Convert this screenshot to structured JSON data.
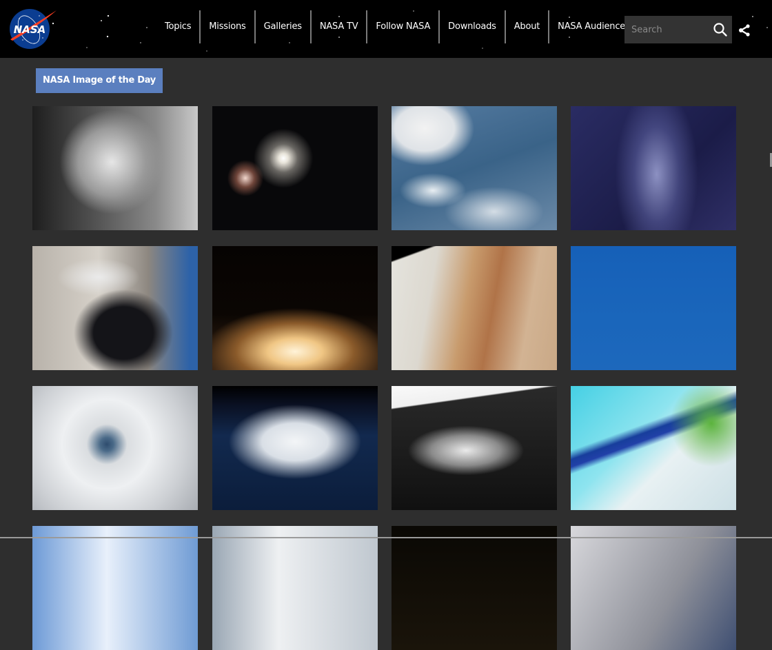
{
  "header": {
    "logo_alt": "NASA",
    "logo_text": "NASA",
    "nav": [
      {
        "label": "Topics"
      },
      {
        "label": "Missions"
      },
      {
        "label": "Galleries"
      },
      {
        "label": "NASA TV"
      },
      {
        "label": "Follow NASA"
      },
      {
        "label": "Downloads"
      },
      {
        "label": "About"
      },
      {
        "label": "NASA Audiences ·"
      }
    ],
    "search": {
      "placeholder": "Search",
      "value": ""
    },
    "icons": {
      "search": "search-icon",
      "share": "share-icon"
    }
  },
  "page": {
    "title": "NASA Image of the Day"
  },
  "gallery": {
    "items": [
      {
        "subject": "astronaut-in-helmet-bw",
        "colors": [
          "#2a2a2a",
          "#d8d8d8"
        ]
      },
      {
        "subject": "galaxy-bright-core",
        "colors": [
          "#0a0a0c",
          "#f0efe8"
        ]
      },
      {
        "subject": "cubesat-over-earth",
        "colors": [
          "#3c5f87",
          "#e6ebef"
        ]
      },
      {
        "subject": "milky-way",
        "colors": [
          "#1d1f4a",
          "#8e8fc4"
        ]
      },
      {
        "subject": "astronaut-with-camera-iss",
        "colors": [
          "#1a1a1e",
          "#cfcac4"
        ]
      },
      {
        "subject": "rocket-launch-night",
        "colors": [
          "#0b0603",
          "#f4d9a4"
        ]
      },
      {
        "subject": "jupiter-clouds",
        "colors": [
          "#c69565",
          "#e8e6df"
        ]
      },
      {
        "subject": "aircraft-blue-sky",
        "colors": [
          "#1a63b8",
          "#ffffff"
        ]
      },
      {
        "subject": "hurricane-eye",
        "colors": [
          "#dadcdf",
          "#2f4a6a"
        ]
      },
      {
        "subject": "hurricane-from-iss",
        "colors": [
          "#0e1f3e",
          "#e8ecf0"
        ]
      },
      {
        "subject": "ceres-crater-bw",
        "colors": [
          "#1c1c1c",
          "#f5f5f5"
        ]
      },
      {
        "subject": "glacier-false-color",
        "colors": [
          "#3bd6e6",
          "#4ea43a"
        ]
      },
      {
        "subject": "partial-row-sky",
        "colors": [
          "#5b8fd0",
          "#e8f0fa"
        ]
      },
      {
        "subject": "partial-row-clouds",
        "colors": [
          "#8c9aa8",
          "#f0f0f0"
        ]
      },
      {
        "subject": "partial-row-night",
        "colors": [
          "#0a0804",
          "#d7a23d"
        ]
      },
      {
        "subject": "partial-row-station",
        "colors": [
          "#bcbcc0",
          "#41506f"
        ]
      }
    ]
  },
  "colors": {
    "header_bg": "#000000",
    "page_bg": "#2e2e2e",
    "badge_bg": "#5b7fbf",
    "search_bg": "#333333",
    "nav_separator": "#7a7a7a"
  }
}
